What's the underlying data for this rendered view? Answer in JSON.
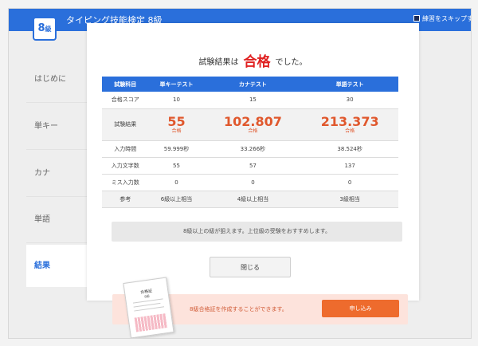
{
  "header": {
    "logo_main": "8",
    "logo_sub": "級",
    "title": "タイピング技能検定 8級",
    "skip_label": "練習をスキップする"
  },
  "sidebar": {
    "items": [
      {
        "label": "はじめに",
        "active": false
      },
      {
        "label": "単キー",
        "active": false
      },
      {
        "label": "カナ",
        "active": false
      },
      {
        "label": "単語",
        "active": false
      },
      {
        "label": "結果",
        "active": true
      }
    ]
  },
  "result": {
    "prefix": "試験結果は",
    "status": "合格",
    "suffix": "でした。"
  },
  "table": {
    "headers": [
      "試験科目",
      "単キーテスト",
      "カナテスト",
      "単語テスト"
    ],
    "pass_score": {
      "label": "合格スコア",
      "values": [
        "10",
        "15",
        "30"
      ]
    },
    "result_row": {
      "label": "試験結果",
      "values": [
        "55",
        "102.807",
        "213.373"
      ],
      "status": [
        "合格",
        "合格",
        "合格"
      ]
    },
    "input_time": {
      "label": "入力時間",
      "values": [
        "59.999秒",
        "33.266秒",
        "38.524秒"
      ]
    },
    "char_count": {
      "label": "入力文字数",
      "values": [
        "55",
        "57",
        "137"
      ]
    },
    "miss_count": {
      "label": "ミス入力数",
      "values": [
        "0",
        "0",
        "0"
      ]
    },
    "reference": {
      "label": "参考",
      "values": [
        "6級以上相当",
        "4級以上相当",
        "3級相当"
      ]
    }
  },
  "advice": "8級以上の級が狙えます。上位級の受験をおすすめします。",
  "close_label": "閉じる",
  "certificate": {
    "message": "8級合格証を作成することができます。",
    "apply_label": "申し込み",
    "doc_title": "合格証",
    "doc_grade": "8級"
  },
  "colors": {
    "accent": "#2a6fdb",
    "pass_red": "#e02020",
    "score_orange": "#e0582d",
    "apply_orange": "#ee6b2d"
  }
}
